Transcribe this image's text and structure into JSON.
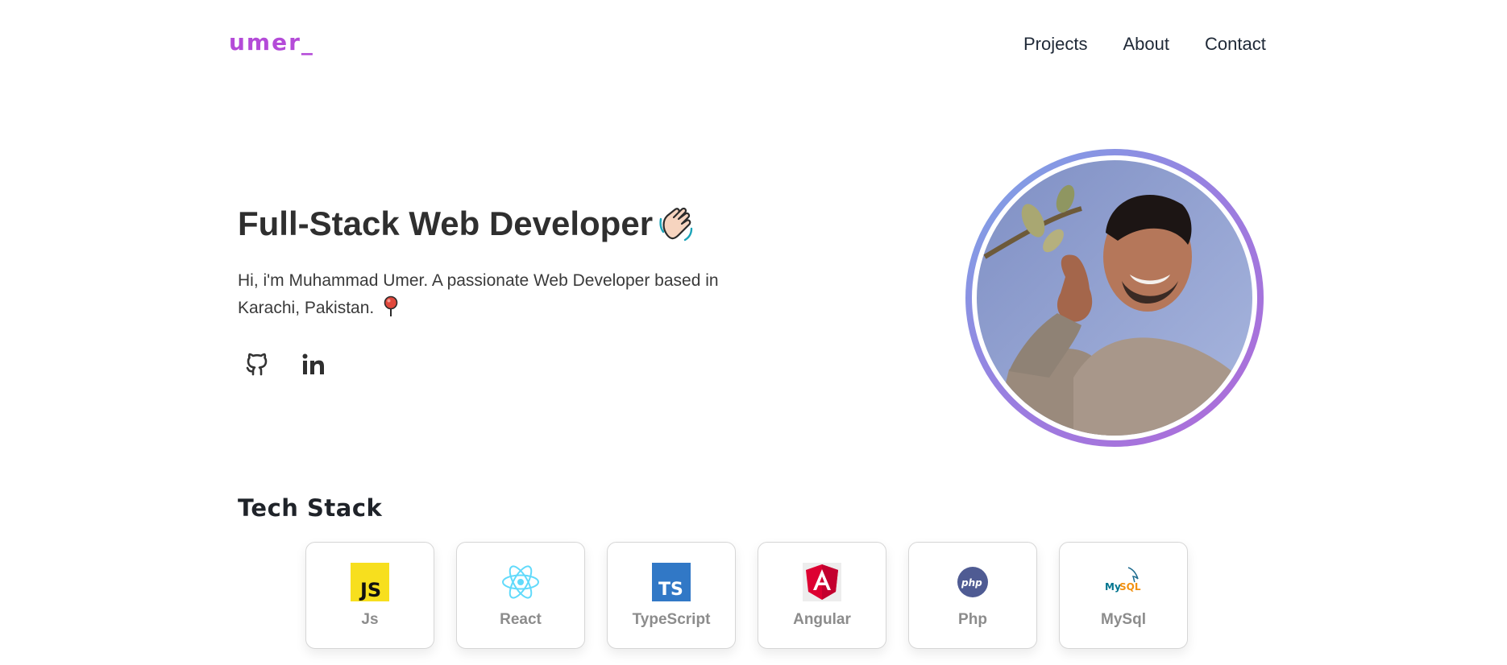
{
  "header": {
    "logo": "umer_",
    "nav": [
      {
        "label": "Projects"
      },
      {
        "label": "About"
      },
      {
        "label": "Contact"
      }
    ]
  },
  "hero": {
    "title": "Full-Stack Web Developer",
    "intro": "Hi, i'm Muhammad Umer. A passionate Web Developer based in Karachi, Pakistan.",
    "title_icon": "waving-hand-icon",
    "intro_icon": "pin-icon",
    "socials": [
      {
        "icon": "github-icon"
      },
      {
        "icon": "linkedin-icon"
      }
    ],
    "avatar_gradient": [
      "#7aa7e6",
      "#b06ad8"
    ]
  },
  "tech_stack": {
    "title": "Tech Stack",
    "items": [
      {
        "name": "Js",
        "icon": "javascript-icon"
      },
      {
        "name": "React",
        "icon": "react-icon"
      },
      {
        "name": "TypeScript",
        "icon": "typescript-icon"
      },
      {
        "name": "Angular",
        "icon": "angular-icon"
      },
      {
        "name": "Php",
        "icon": "php-icon"
      },
      {
        "name": "MySql",
        "icon": "mysql-icon"
      }
    ]
  },
  "colors": {
    "logo": "#b44bd8",
    "text": "#2f2f2f",
    "card_label": "#8c8c8c"
  }
}
